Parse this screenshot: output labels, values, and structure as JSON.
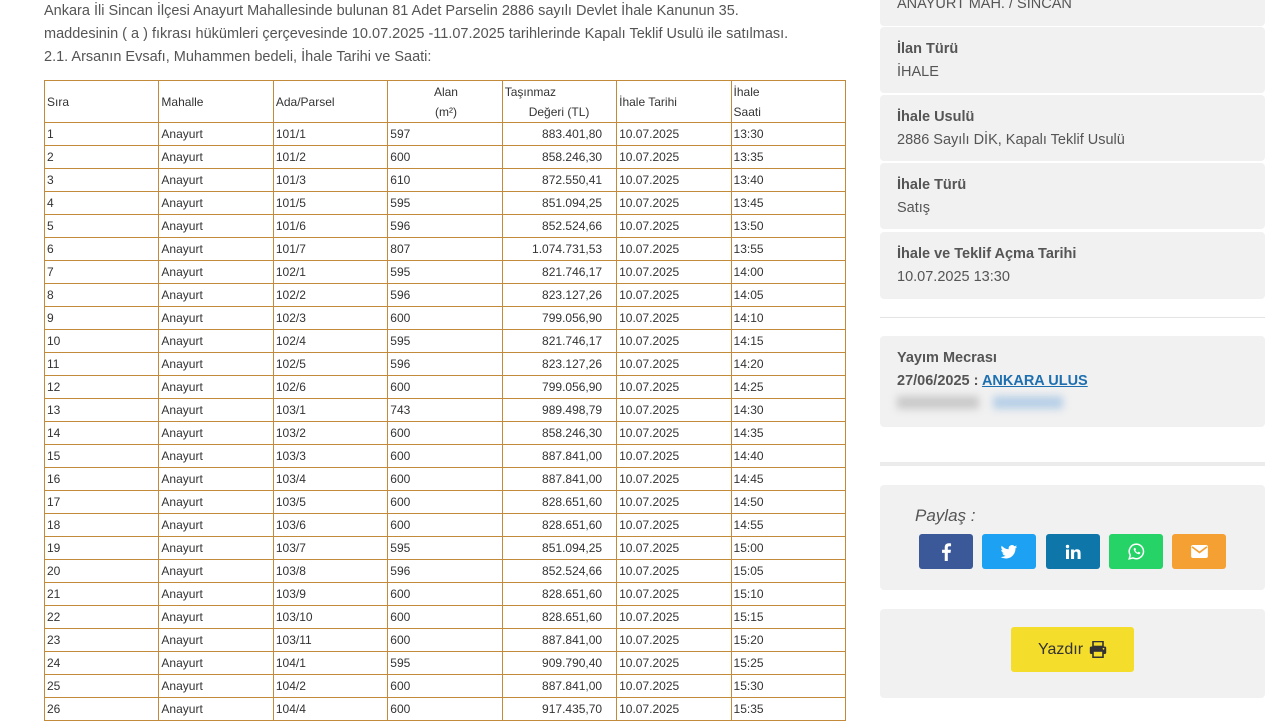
{
  "intro": {
    "line1": "Ankara İli Sincan İlçesi Anayurt Mahallesinde bulunan 81 Adet Parselin 2886 sayılı Devlet İhale Kanunun 35.",
    "line2": "maddesinin ( a ) fıkrası hükümleri çerçevesinde 10.07.2025 -11.07.2025 tarihlerinde Kapalı Teklif Usulü ile satılması.",
    "line3": "2.1. Arsanın Evsafı, Muhammen bedeli, İhale Tarihi ve Saati:"
  },
  "table": {
    "headers": {
      "sira": "Sıra",
      "mahalle": "Mahalle",
      "ada": "Ada/Parsel",
      "alan1": "Alan",
      "alan2": "(m²)",
      "deger1": "Taşınmaz",
      "deger2": "Değeri (TL)",
      "tarih": "İhale Tarihi",
      "saat1": "İhale",
      "saat2": "Saati"
    },
    "rows": [
      [
        "1",
        "Anayurt",
        "101/1",
        "597",
        "883.401,80",
        "10.07.2025",
        "13:30"
      ],
      [
        "2",
        "Anayurt",
        "101/2",
        "600",
        "858.246,30",
        "10.07.2025",
        "13:35"
      ],
      [
        "3",
        "Anayurt",
        "101/3",
        "610",
        "872.550,41",
        "10.07.2025",
        "13:40"
      ],
      [
        "4",
        "Anayurt",
        "101/5",
        "595",
        "851.094,25",
        "10.07.2025",
        "13:45"
      ],
      [
        "5",
        "Anayurt",
        "101/6",
        "596",
        "852.524,66",
        "10.07.2025",
        "13:50"
      ],
      [
        "6",
        "Anayurt",
        "101/7",
        "807",
        "1.074.731,53",
        "10.07.2025",
        "13:55"
      ],
      [
        "7",
        "Anayurt",
        "102/1",
        "595",
        "821.746,17",
        "10.07.2025",
        "14:00"
      ],
      [
        "8",
        "Anayurt",
        "102/2",
        "596",
        "823.127,26",
        "10.07.2025",
        "14:05"
      ],
      [
        "9",
        "Anayurt",
        "102/3",
        "600",
        "799.056,90",
        "10.07.2025",
        "14:10"
      ],
      [
        "10",
        "Anayurt",
        "102/4",
        "595",
        "821.746,17",
        "10.07.2025",
        "14:15"
      ],
      [
        "11",
        "Anayurt",
        "102/5",
        "596",
        "823.127,26",
        "10.07.2025",
        "14:20"
      ],
      [
        "12",
        "Anayurt",
        "102/6",
        "600",
        "799.056,90",
        "10.07.2025",
        "14:25"
      ],
      [
        "13",
        "Anayurt",
        "103/1",
        "743",
        "989.498,79",
        "10.07.2025",
        "14:30"
      ],
      [
        "14",
        "Anayurt",
        "103/2",
        "600",
        "858.246,30",
        "10.07.2025",
        "14:35"
      ],
      [
        "15",
        "Anayurt",
        "103/3",
        "600",
        "887.841,00",
        "10.07.2025",
        "14:40"
      ],
      [
        "16",
        "Anayurt",
        "103/4",
        "600",
        "887.841,00",
        "10.07.2025",
        "14:45"
      ],
      [
        "17",
        "Anayurt",
        "103/5",
        "600",
        "828.651,60",
        "10.07.2025",
        "14:50"
      ],
      [
        "18",
        "Anayurt",
        "103/6",
        "600",
        "828.651,60",
        "10.07.2025",
        "14:55"
      ],
      [
        "19",
        "Anayurt",
        "103/7",
        "595",
        "851.094,25",
        "10.07.2025",
        "15:00"
      ],
      [
        "20",
        "Anayurt",
        "103/8",
        "596",
        "852.524,66",
        "10.07.2025",
        "15:05"
      ],
      [
        "21",
        "Anayurt",
        "103/9",
        "600",
        "828.651,60",
        "10.07.2025",
        "15:10"
      ],
      [
        "22",
        "Anayurt",
        "103/10",
        "600",
        "828.651,60",
        "10.07.2025",
        "15:15"
      ],
      [
        "23",
        "Anayurt",
        "103/11",
        "600",
        "887.841,00",
        "10.07.2025",
        "15:20"
      ],
      [
        "24",
        "Anayurt",
        "104/1",
        "595",
        "909.790,40",
        "10.07.2025",
        "15:25"
      ],
      [
        "25",
        "Anayurt",
        "104/2",
        "600",
        "887.841,00",
        "10.07.2025",
        "15:30"
      ],
      [
        "26",
        "Anayurt",
        "104/4",
        "600",
        "917.435,70",
        "10.07.2025",
        "15:35"
      ]
    ]
  },
  "sidebar": {
    "location": "ANAYURT MAH. / SİNCAN",
    "ilan_turu_title": "İlan Türü",
    "ilan_turu_value": "İHALE",
    "ihale_usulu_title": "İhale Usulü",
    "ihale_usulu_value": "2886 Sayılı DİK, Kapalı Teklif Usulü",
    "ihale_turu_title": "İhale Türü",
    "ihale_turu_value": "Satış",
    "tarih_title": "İhale ve Teklif Açma Tarihi",
    "tarih_value": "10.07.2025 13:30",
    "yayim_title": "Yayım Mecrası",
    "yayim_date": "27/06/2025 :",
    "yayim_link": "ANKARA ULUS",
    "share_label": "Paylaş :",
    "print_label": "Yazdır"
  },
  "colors": {
    "facebook": "#3b5998",
    "twitter": "#1da1f2",
    "linkedin": "#0e76a8",
    "whatsapp": "#25d366",
    "email": "#f5a033",
    "print": "#f5dd2c",
    "table_border": "#c48a3c",
    "link": "#1e6fb0"
  },
  "icons": {
    "facebook": "facebook-icon",
    "twitter": "twitter-icon",
    "linkedin": "linkedin-icon",
    "whatsapp": "whatsapp-icon",
    "email": "envelope-icon",
    "print": "printer-icon"
  }
}
